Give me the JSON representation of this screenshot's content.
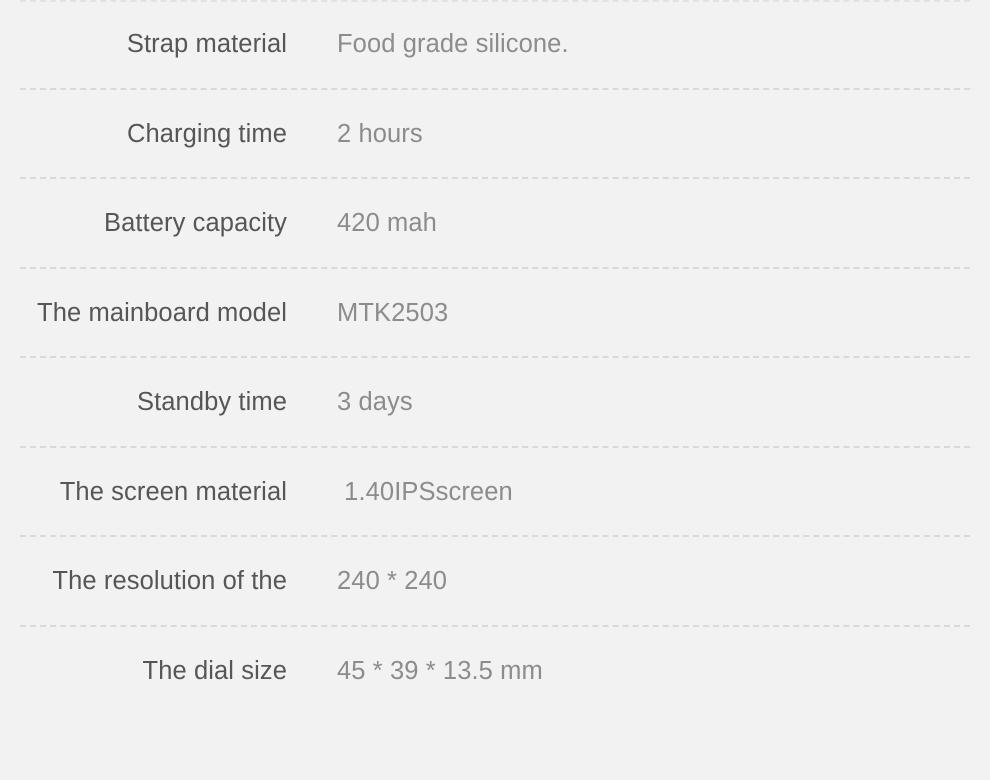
{
  "page": {
    "background_color": "#f2f2f2",
    "label_color": "#565656",
    "value_color": "#8c8c8c",
    "divider_color": "#d9d9d9"
  },
  "spec_table": {
    "rows": [
      {
        "label": "Strap material",
        "value": "Food grade silicone."
      },
      {
        "label": "Charging time",
        "value": "2 hours"
      },
      {
        "label": "Battery capacity",
        "value": "420 mah"
      },
      {
        "label": "The mainboard model",
        "value": "MTK2503"
      },
      {
        "label": "Standby time",
        "value": "3 days"
      },
      {
        "label": "The screen material",
        "value": " 1.40IPSscreen"
      },
      {
        "label": "The resolution of the",
        "value": "240 * 240"
      },
      {
        "label": "The dial size",
        "value": "45 * 39 * 13.5 mm"
      }
    ]
  }
}
